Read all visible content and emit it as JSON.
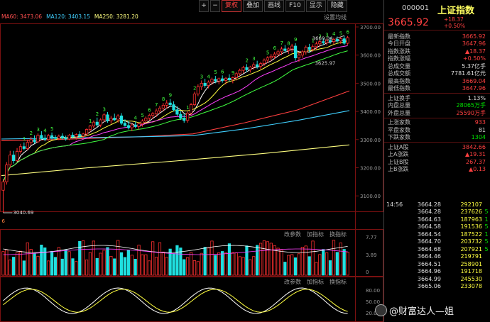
{
  "toolbar": {
    "items": [
      {
        "label": "+",
        "active": false,
        "sym": true
      },
      {
        "label": "−",
        "active": false,
        "sym": true
      },
      {
        "label": "复权",
        "active": true,
        "sym": false
      },
      {
        "label": "叠加",
        "active": false,
        "sym": false
      },
      {
        "label": "画线",
        "active": false,
        "sym": false
      },
      {
        "label": "F10",
        "active": false,
        "sym": false
      },
      {
        "label": "显示",
        "active": false,
        "sym": false
      },
      {
        "label": "隐藏",
        "active": false,
        "sym": false
      }
    ]
  },
  "ma_legend": [
    {
      "label": "MA60: 3473.06",
      "color": "#ff5050"
    },
    {
      "label": "MA120: 3403.15",
      "color": "#40d0ff"
    },
    {
      "label": "MA250: 3281.20",
      "color": "#ffff80"
    }
  ],
  "settings_label": "设置均线",
  "price_axis": [
    "3700.00",
    "3600.00",
    "3500.00",
    "3400.00",
    "3300.00",
    "3200.00",
    "3100.00"
  ],
  "annotations": {
    "high": "3669.04",
    "low": "3040.69",
    "bottom_mark": "6",
    "right_mark": "3625.97"
  },
  "td_numbers": [
    {
      "t": "1",
      "c": 6
    },
    {
      "t": "2",
      "c": 8
    },
    {
      "t": "3",
      "c": 10
    },
    {
      "t": "4",
      "c": 12
    },
    {
      "t": "5",
      "c": 14
    },
    {
      "t": "1",
      "c": 25
    },
    {
      "t": "2",
      "c": 27
    },
    {
      "t": "3",
      "c": 29
    },
    {
      "t": "4",
      "c": 38
    },
    {
      "t": "5",
      "c": 40
    },
    {
      "t": "6",
      "c": 42
    },
    {
      "t": "7",
      "c": 44
    },
    {
      "t": "8",
      "c": 46
    },
    {
      "t": "9",
      "c": 48
    },
    {
      "t": "1",
      "c": 53
    },
    {
      "t": "2",
      "c": 55
    },
    {
      "t": "3",
      "c": 57
    },
    {
      "t": "4",
      "c": 59
    },
    {
      "t": "5",
      "c": 61
    },
    {
      "t": "6",
      "c": 63
    },
    {
      "t": "9",
      "c": 66
    },
    {
      "t": "2",
      "c": 70
    },
    {
      "t": "3",
      "c": 72
    },
    {
      "t": "5",
      "c": 76
    },
    {
      "t": "6",
      "c": 78
    },
    {
      "t": "7",
      "c": 80
    },
    {
      "t": "8",
      "c": 82
    },
    {
      "t": "9",
      "c": 84
    },
    {
      "t": "1",
      "c": 89
    },
    {
      "t": "2",
      "c": 91
    },
    {
      "t": "3",
      "c": 93
    },
    {
      "t": "4",
      "c": 95
    },
    {
      "t": "5",
      "c": 97
    },
    {
      "t": "6",
      "c": 99
    }
  ],
  "vol_legend": [
    "改参数",
    "加指标",
    "换指标"
  ],
  "vol_axis": [
    "7.77",
    "3.89",
    "0"
  ],
  "osc_legend": [
    "改参数",
    "加指标",
    "换指标"
  ],
  "osc_axis": [
    "80.00",
    "50.00",
    "20.00"
  ],
  "chart_data": {
    "type": "candlestick",
    "ylim": [
      3040,
      3700
    ],
    "candles": [
      {
        "o": 3120,
        "h": 3160,
        "l": 3040,
        "c": 3150
      },
      {
        "o": 3150,
        "h": 3220,
        "l": 3140,
        "c": 3210
      },
      {
        "o": 3210,
        "h": 3260,
        "l": 3200,
        "c": 3245
      },
      {
        "o": 3245,
        "h": 3260,
        "l": 3215,
        "c": 3225
      },
      {
        "o": 3225,
        "h": 3270,
        "l": 3220,
        "c": 3258
      },
      {
        "o": 3258,
        "h": 3285,
        "l": 3250,
        "c": 3275
      },
      {
        "o": 3275,
        "h": 3290,
        "l": 3262,
        "c": 3268
      },
      {
        "o": 3268,
        "h": 3300,
        "l": 3262,
        "c": 3290
      },
      {
        "o": 3290,
        "h": 3310,
        "l": 3280,
        "c": 3300
      },
      {
        "o": 3300,
        "h": 3315,
        "l": 3286,
        "c": 3292
      },
      {
        "o": 3292,
        "h": 3322,
        "l": 3288,
        "c": 3315
      },
      {
        "o": 3315,
        "h": 3330,
        "l": 3300,
        "c": 3305
      },
      {
        "o": 3305,
        "h": 3318,
        "l": 3294,
        "c": 3300
      },
      {
        "o": 3300,
        "h": 3320,
        "l": 3296,
        "c": 3314
      },
      {
        "o": 3314,
        "h": 3325,
        "l": 3300,
        "c": 3308
      },
      {
        "o": 3308,
        "h": 3316,
        "l": 3298,
        "c": 3304
      },
      {
        "o": 3304,
        "h": 3318,
        "l": 3298,
        "c": 3312
      },
      {
        "o": 3312,
        "h": 3322,
        "l": 3300,
        "c": 3306
      },
      {
        "o": 3306,
        "h": 3314,
        "l": 3296,
        "c": 3302
      },
      {
        "o": 3302,
        "h": 3320,
        "l": 3298,
        "c": 3316
      },
      {
        "o": 3316,
        "h": 3326,
        "l": 3304,
        "c": 3310
      },
      {
        "o": 3310,
        "h": 3322,
        "l": 3300,
        "c": 3318
      },
      {
        "o": 3318,
        "h": 3330,
        "l": 3308,
        "c": 3312
      },
      {
        "o": 3312,
        "h": 3324,
        "l": 3304,
        "c": 3320
      },
      {
        "o": 3320,
        "h": 3340,
        "l": 3312,
        "c": 3336
      },
      {
        "o": 3336,
        "h": 3352,
        "l": 3326,
        "c": 3348
      },
      {
        "o": 3348,
        "h": 3368,
        "l": 3340,
        "c": 3362
      },
      {
        "o": 3362,
        "h": 3378,
        "l": 3346,
        "c": 3352
      },
      {
        "o": 3352,
        "h": 3376,
        "l": 3344,
        "c": 3370
      },
      {
        "o": 3370,
        "h": 3394,
        "l": 3362,
        "c": 3388
      },
      {
        "o": 3388,
        "h": 3398,
        "l": 3360,
        "c": 3366
      },
      {
        "o": 3366,
        "h": 3384,
        "l": 3356,
        "c": 3376
      },
      {
        "o": 3376,
        "h": 3392,
        "l": 3366,
        "c": 3370
      },
      {
        "o": 3370,
        "h": 3390,
        "l": 3360,
        "c": 3384
      },
      {
        "o": 3384,
        "h": 3394,
        "l": 3352,
        "c": 3358
      },
      {
        "o": 3358,
        "h": 3372,
        "l": 3346,
        "c": 3350
      },
      {
        "o": 3350,
        "h": 3366,
        "l": 3336,
        "c": 3342
      },
      {
        "o": 3342,
        "h": 3358,
        "l": 3330,
        "c": 3352
      },
      {
        "o": 3352,
        "h": 3364,
        "l": 3340,
        "c": 3346
      },
      {
        "o": 3346,
        "h": 3360,
        "l": 3336,
        "c": 3356
      },
      {
        "o": 3356,
        "h": 3372,
        "l": 3346,
        "c": 3366
      },
      {
        "o": 3366,
        "h": 3382,
        "l": 3356,
        "c": 3376
      },
      {
        "o": 3376,
        "h": 3392,
        "l": 3368,
        "c": 3386
      },
      {
        "o": 3386,
        "h": 3398,
        "l": 3372,
        "c": 3392
      },
      {
        "o": 3392,
        "h": 3410,
        "l": 3380,
        "c": 3402
      },
      {
        "o": 3402,
        "h": 3420,
        "l": 3392,
        "c": 3412
      },
      {
        "o": 3412,
        "h": 3430,
        "l": 3400,
        "c": 3422
      },
      {
        "o": 3422,
        "h": 3440,
        "l": 3410,
        "c": 3430
      },
      {
        "o": 3430,
        "h": 3444,
        "l": 3416,
        "c": 3424
      },
      {
        "o": 3424,
        "h": 3436,
        "l": 3400,
        "c": 3406
      },
      {
        "o": 3406,
        "h": 3418,
        "l": 3384,
        "c": 3390
      },
      {
        "o": 3390,
        "h": 3402,
        "l": 3370,
        "c": 3376
      },
      {
        "o": 3376,
        "h": 3392,
        "l": 3360,
        "c": 3368
      },
      {
        "o": 3368,
        "h": 3400,
        "l": 3360,
        "c": 3394
      },
      {
        "o": 3394,
        "h": 3430,
        "l": 3386,
        "c": 3424
      },
      {
        "o": 3424,
        "h": 3470,
        "l": 3418,
        "c": 3462
      },
      {
        "o": 3462,
        "h": 3496,
        "l": 3454,
        "c": 3488
      },
      {
        "o": 3488,
        "h": 3510,
        "l": 3476,
        "c": 3500
      },
      {
        "o": 3500,
        "h": 3516,
        "l": 3484,
        "c": 3492
      },
      {
        "o": 3492,
        "h": 3510,
        "l": 3482,
        "c": 3504
      },
      {
        "o": 3504,
        "h": 3520,
        "l": 3494,
        "c": 3514
      },
      {
        "o": 3514,
        "h": 3526,
        "l": 3500,
        "c": 3508
      },
      {
        "o": 3508,
        "h": 3520,
        "l": 3496,
        "c": 3516
      },
      {
        "o": 3516,
        "h": 3528,
        "l": 3502,
        "c": 3510
      },
      {
        "o": 3510,
        "h": 3522,
        "l": 3496,
        "c": 3518
      },
      {
        "o": 3518,
        "h": 3532,
        "l": 3506,
        "c": 3512
      },
      {
        "o": 3512,
        "h": 3524,
        "l": 3500,
        "c": 3520
      },
      {
        "o": 3520,
        "h": 3540,
        "l": 3510,
        "c": 3534
      },
      {
        "o": 3534,
        "h": 3552,
        "l": 3526,
        "c": 3546
      },
      {
        "o": 3546,
        "h": 3562,
        "l": 3536,
        "c": 3556
      },
      {
        "o": 3556,
        "h": 3568,
        "l": 3540,
        "c": 3548
      },
      {
        "o": 3548,
        "h": 3562,
        "l": 3538,
        "c": 3558
      },
      {
        "o": 3558,
        "h": 3574,
        "l": 3548,
        "c": 3566
      },
      {
        "o": 3566,
        "h": 3580,
        "l": 3552,
        "c": 3560
      },
      {
        "o": 3560,
        "h": 3576,
        "l": 3550,
        "c": 3570
      },
      {
        "o": 3570,
        "h": 3588,
        "l": 3562,
        "c": 3582
      },
      {
        "o": 3582,
        "h": 3596,
        "l": 3572,
        "c": 3590
      },
      {
        "o": 3590,
        "h": 3604,
        "l": 3578,
        "c": 3596
      },
      {
        "o": 3596,
        "h": 3612,
        "l": 3586,
        "c": 3604
      },
      {
        "o": 3604,
        "h": 3620,
        "l": 3594,
        "c": 3612
      },
      {
        "o": 3612,
        "h": 3630,
        "l": 3600,
        "c": 3622
      },
      {
        "o": 3622,
        "h": 3636,
        "l": 3610,
        "c": 3616
      },
      {
        "o": 3616,
        "h": 3628,
        "l": 3604,
        "c": 3622
      },
      {
        "o": 3622,
        "h": 3640,
        "l": 3610,
        "c": 3632
      },
      {
        "o": 3632,
        "h": 3642,
        "l": 3580,
        "c": 3590
      },
      {
        "o": 3590,
        "h": 3612,
        "l": 3576,
        "c": 3600
      },
      {
        "o": 3600,
        "h": 3618,
        "l": 3590,
        "c": 3612
      },
      {
        "o": 3612,
        "h": 3634,
        "l": 3602,
        "c": 3628
      },
      {
        "o": 3628,
        "h": 3640,
        "l": 3610,
        "c": 3620
      },
      {
        "o": 3620,
        "h": 3638,
        "l": 3612,
        "c": 3630
      },
      {
        "o": 3630,
        "h": 3648,
        "l": 3620,
        "c": 3640
      },
      {
        "o": 3640,
        "h": 3654,
        "l": 3628,
        "c": 3648
      },
      {
        "o": 3648,
        "h": 3660,
        "l": 3636,
        "c": 3644
      },
      {
        "o": 3644,
        "h": 3658,
        "l": 3634,
        "c": 3652
      },
      {
        "o": 3652,
        "h": 3664,
        "l": 3640,
        "c": 3648
      },
      {
        "o": 3648,
        "h": 3662,
        "l": 3638,
        "c": 3656
      },
      {
        "o": 3656,
        "h": 3666,
        "l": 3644,
        "c": 3650
      },
      {
        "o": 3650,
        "h": 3664,
        "l": 3640,
        "c": 3658
      },
      {
        "o": 3658,
        "h": 3669,
        "l": 3636,
        "c": 3642
      },
      {
        "o": 3642,
        "h": 3668,
        "l": 3636,
        "c": 3662
      }
    ],
    "volume_max": 7.77,
    "ma_lines": [
      {
        "name": "MA60",
        "color": "#ff4040",
        "points": [
          [
            0,
            3296
          ],
          [
            15,
            3300
          ],
          [
            30,
            3306
          ],
          [
            40,
            3310
          ],
          [
            55,
            3320
          ],
          [
            70,
            3360
          ],
          [
            85,
            3405
          ],
          [
            100,
            3473
          ]
        ]
      },
      {
        "name": "MA120",
        "color": "#40d0ff",
        "points": [
          [
            0,
            3302
          ],
          [
            20,
            3306
          ],
          [
            40,
            3310
          ],
          [
            55,
            3314
          ],
          [
            70,
            3338
          ],
          [
            85,
            3368
          ],
          [
            100,
            3403
          ]
        ]
      },
      {
        "name": "MA250",
        "color": "#ffff80",
        "points": [
          [
            0,
            3172
          ],
          [
            25,
            3200
          ],
          [
            50,
            3224
          ],
          [
            75,
            3250
          ],
          [
            100,
            3281
          ]
        ]
      }
    ]
  },
  "panel": {
    "code": "000001",
    "name": "上证指数",
    "price": "3665.92",
    "chg1": "+18.37",
    "chg2": "+0.50%",
    "group1": [
      {
        "k": "最新指数",
        "v": "3665.92",
        "c": "red"
      },
      {
        "k": "今日开盘",
        "v": "3647.96",
        "c": "red"
      },
      {
        "k": "指数涨跌",
        "v": "▲18.37",
        "c": "red"
      },
      {
        "k": "指数涨幅",
        "v": "+0.50%",
        "c": "red"
      },
      {
        "k": "总成交量",
        "v": "5.37亿手",
        "c": "white"
      },
      {
        "k": "总成交额",
        "v": "7781.61亿元",
        "c": "white"
      },
      {
        "k": "最高指数",
        "v": "3669.04",
        "c": "red"
      },
      {
        "k": "最低指数",
        "v": "3647.96",
        "c": "red"
      }
    ],
    "group2": [
      {
        "k": "上证换手",
        "v": "1.13%",
        "c": "white"
      },
      {
        "k": "内盘总量",
        "v": "28065万手",
        "c": "green"
      },
      {
        "k": "外盘总量",
        "v": "25590万手",
        "c": "red"
      }
    ],
    "group3": [
      {
        "k": "上涨家数",
        "v": "933",
        "c": "red"
      },
      {
        "k": "平盘家数",
        "v": "81",
        "c": "white"
      },
      {
        "k": "下跌家数",
        "v": "1304",
        "c": "green"
      }
    ],
    "group4": [
      {
        "k": "上证A股",
        "v": "3842.66",
        "c": "red"
      },
      {
        "k": "上A涨跌",
        "v": "▲19.31",
        "c": "red"
      },
      {
        "k": "上证B股",
        "v": "267.37",
        "c": "red"
      },
      {
        "k": "上B涨跌",
        "v": "▲0.13",
        "c": "red"
      }
    ],
    "ticks": [
      {
        "t": "14:56",
        "p": "3664.28",
        "v": "292107",
        "d": ""
      },
      {
        "t": "",
        "p": "3664.28",
        "v": "237626",
        "d": "5"
      },
      {
        "t": "",
        "p": "3664.63",
        "v": "187963",
        "d": "1"
      },
      {
        "t": "",
        "p": "3664.58",
        "v": "191536",
        "d": "5"
      },
      {
        "t": "",
        "p": "3664.54",
        "v": "187522",
        "d": "1"
      },
      {
        "t": "",
        "p": "3664.70",
        "v": "203732",
        "d": "5"
      },
      {
        "t": "",
        "p": "3664.68",
        "v": "207921",
        "d": "5"
      },
      {
        "t": "",
        "p": "3664.46",
        "v": "219791",
        "d": ""
      },
      {
        "t": "",
        "p": "3664.51",
        "v": "258901",
        "d": ""
      },
      {
        "t": "",
        "p": "3664.96",
        "v": "191718",
        "d": ""
      },
      {
        "t": "",
        "p": "3664.99",
        "v": "245530",
        "d": ""
      },
      {
        "t": "",
        "p": "3665.06",
        "v": "233078",
        "d": ""
      }
    ]
  },
  "watermark": "@财富达人—姐"
}
